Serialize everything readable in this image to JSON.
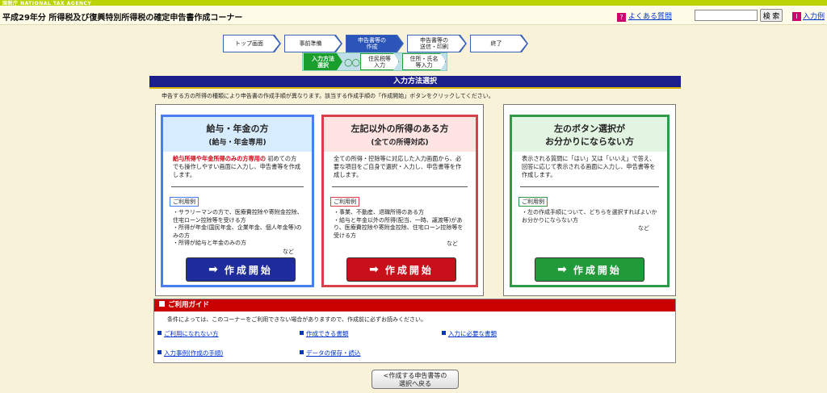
{
  "agency": "国税庁 NATIONAL TAX AGENCY",
  "header": {
    "title": "平成29年分 所得税及び復興特別所得税の確定申告書作成コーナー",
    "faq_label": "よくある質問",
    "search_placeholder": "",
    "search_button": "検 索",
    "help_label": "入力例"
  },
  "steps": [
    "トップ画面",
    "事前準備",
    "申告書等の\n作成",
    "申告書等の\n送信・印刷",
    "終了"
  ],
  "substeps": [
    "入力方法\n選択",
    "住民税等\n入力",
    "住所・氏名\n等入力"
  ],
  "section_title": "入力方法選択",
  "instruction": "申告する方の所得の種類により申告書の作成手順が異なります。該当する作成手順の「作成開始」ボタンをクリックしてください。",
  "cards": [
    {
      "title": "給与・年金の方",
      "subtitle": "(給与・年金専用)",
      "desc_red": "給与所得や年金所得のみの方専用の",
      "desc": "初めての方でも操作しやすい画面に入力し、申告書等を作成します。",
      "usage_label": "ご利用例",
      "uses": [
        "・サラリーマンの方で、医療費控除や寄附金控除、住宅ローン控除等を受ける方",
        "・所得が年金(国民年金、企業年金、個人年金等)のみの方",
        "・所得が給与と年金のみの方"
      ],
      "etc": "など",
      "button": "作成開始"
    },
    {
      "title": "左記以外の所得のある方",
      "subtitle": "(全ての所得対応)",
      "desc": "全ての所得・控除等に対応した入力画面から、必要な項目をご自身で選択・入力し、申告書等を作成します。",
      "usage_label": "ご利用例",
      "uses": [
        "・事業、不動産、退職所得のある方",
        "・給与と年金以外の所得(配当、一時、譲渡等)があり、医療費控除や寄附金控除、住宅ローン控除等を受ける方"
      ],
      "etc": "など",
      "button": "作成開始"
    },
    {
      "title": "左のボタン選択が",
      "subtitle": "お分かりにならない方",
      "desc": "表示される質問に「はい」又は「いいえ」で答え、回答に応じて表示される画面に入力し、申告書等を作成します。",
      "usage_label": "ご利用例",
      "uses": [
        "・左の作成手順について、どちらを選択すればよいかお分かりにならない方"
      ],
      "etc": "など",
      "button": "作成開始"
    }
  ],
  "guide": {
    "title": "ご利用ガイド",
    "note": "条件によっては、このコーナーをご利用できない場合がありますので、作成前に必ずお読みください。",
    "links": [
      "ご利用になれない方",
      "作成できる書類",
      "入力に必要な書類",
      "入力事例(作成の手順)",
      "データの保存・読込"
    ]
  },
  "back_button": "<作成する申告書等の\n選択へ戻る",
  "colors": {
    "navy": "#1a1f8a",
    "red": "#c80000",
    "green": "#219a3a",
    "blue": "#4a7ef0"
  }
}
